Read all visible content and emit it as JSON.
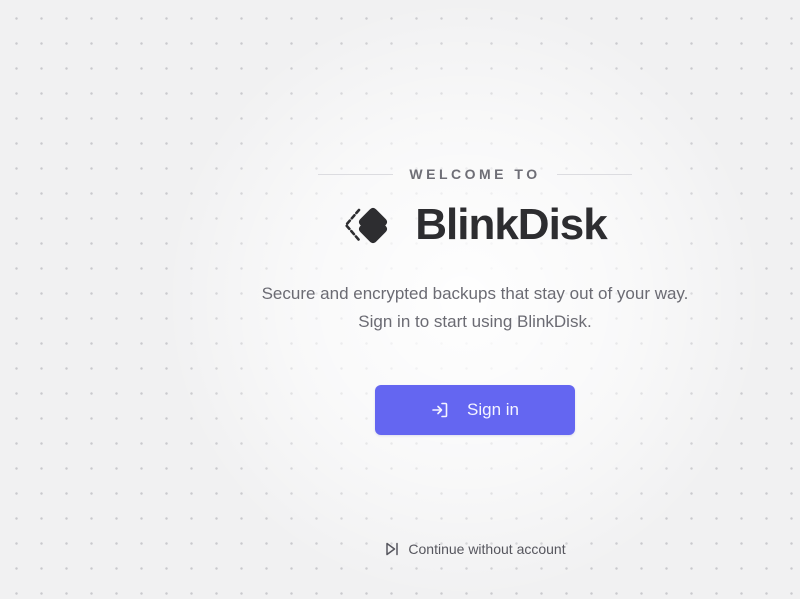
{
  "welcome": {
    "label": "WELCOME TO"
  },
  "brand": {
    "name": "BlinkDisk",
    "logo_icon": "blinkdisk-logo-icon"
  },
  "tagline": "Secure and encrypted backups that stay out of your way. Sign in to start using BlinkDisk.",
  "actions": {
    "sign_in_label": "Sign in",
    "sign_in_icon": "sign-in-icon",
    "continue_label": "Continue without account",
    "continue_icon": "skip-forward-icon"
  },
  "colors": {
    "background": "#f1f1f2",
    "accent": "#6466f1",
    "brand_text": "#2d2d30",
    "muted_text": "#6b6b73"
  }
}
